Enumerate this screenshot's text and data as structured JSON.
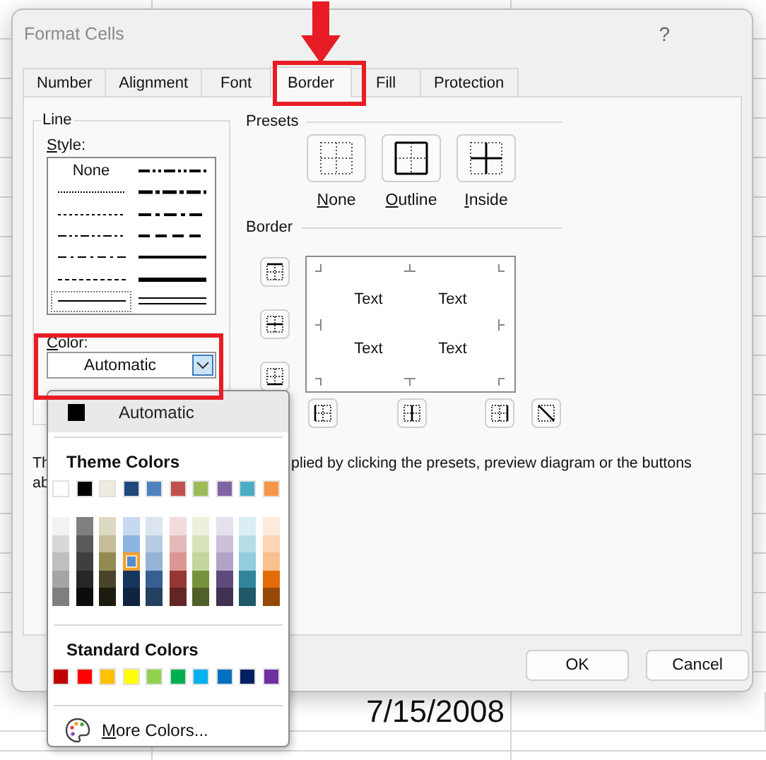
{
  "sheet": {
    "rows": [
      {
        "column_2": "7/15/2008"
      }
    ]
  },
  "window": {
    "title": "Format Cells",
    "help": "?"
  },
  "tabs": [
    {
      "label": "Number",
      "selected": false
    },
    {
      "label": "Alignment",
      "selected": false
    },
    {
      "label": "Font",
      "selected": false
    },
    {
      "label": "Border",
      "selected": true
    },
    {
      "label": "Fill",
      "selected": false
    },
    {
      "label": "Protection",
      "selected": false
    }
  ],
  "line": {
    "title": "Line",
    "style_label": "Style:",
    "styles": [
      {
        "kind": "none",
        "label": "None",
        "selected": false
      },
      {
        "kind": "hair",
        "selected": false
      },
      {
        "kind": "dotted",
        "selected": false
      },
      {
        "kind": "dashdotdot",
        "selected": false
      },
      {
        "kind": "dashdot",
        "selected": false
      },
      {
        "kind": "dashed",
        "selected": false
      },
      {
        "kind": "thin",
        "selected": true
      },
      {
        "kind": "medium_dashdotdot",
        "selected": false
      },
      {
        "kind": "slant_dashdot",
        "selected": false
      },
      {
        "kind": "medium_dashdot",
        "selected": false
      },
      {
        "kind": "medium_dashed",
        "selected": false
      },
      {
        "kind": "medium",
        "selected": false
      },
      {
        "kind": "thick",
        "selected": false
      },
      {
        "kind": "double",
        "selected": false
      }
    ],
    "color_label": "Color:",
    "color_value": "Automatic",
    "color_expanded": true
  },
  "presets": {
    "title": "Presets",
    "buttons": [
      {
        "kind": "none",
        "label": "None"
      },
      {
        "kind": "outline",
        "label": "Outline"
      },
      {
        "kind": "inside",
        "label": "Inside"
      }
    ]
  },
  "border": {
    "title": "Border",
    "side_buttons": [
      {
        "kind": "top"
      },
      {
        "kind": "middle"
      },
      {
        "kind": "bottom"
      }
    ],
    "preview_texts": [
      "Text",
      "Text",
      "Text",
      "Text"
    ],
    "bottom_buttons": [
      {
        "kind": "left"
      },
      {
        "kind": "center"
      },
      {
        "kind": "right"
      },
      {
        "kind": "diagonal_down"
      }
    ]
  },
  "note": {
    "line_1_start": "Th",
    "line_1_end": "plied by clicking the presets, preview diagram or the buttons",
    "line_2_start": "ab"
  },
  "buttons": [
    "OK",
    "Cancel"
  ],
  "color_menu": {
    "automatic": {
      "label": "Automatic",
      "color": "#000000"
    },
    "theme_title": "Theme Colors",
    "theme_colors": [
      {
        "color": "#ffffff",
        "selected": false
      },
      {
        "color": "#000000",
        "selected": false
      },
      {
        "color": "#eeece1",
        "selected": false
      },
      {
        "color": "#1f497d",
        "selected": false
      },
      {
        "color": "#4f81bd",
        "selected": false
      },
      {
        "color": "#c0504d",
        "selected": false
      },
      {
        "color": "#9bbb59",
        "selected": false
      },
      {
        "color": "#8064a2",
        "selected": false
      },
      {
        "color": "#4bacc6",
        "selected": false
      },
      {
        "color": "#f79646",
        "selected": false
      }
    ],
    "theme_shades": [
      [
        {
          "color": "#f2f2f2",
          "selected": false
        },
        {
          "color": "#d8d8d8",
          "selected": false
        },
        {
          "color": "#bfbfbf",
          "selected": false
        },
        {
          "color": "#a5a5a5",
          "selected": false
        },
        {
          "color": "#7f7f7f",
          "selected": false
        }
      ],
      [
        {
          "color": "#7f7f7f",
          "selected": false
        },
        {
          "color": "#595959",
          "selected": false
        },
        {
          "color": "#3f3f3f",
          "selected": false
        },
        {
          "color": "#262626",
          "selected": false
        },
        {
          "color": "#0c0c0c",
          "selected": false
        }
      ],
      [
        {
          "color": "#ddd9c3",
          "selected": false
        },
        {
          "color": "#c4bd97",
          "selected": false
        },
        {
          "color": "#938953",
          "selected": false
        },
        {
          "color": "#494429",
          "selected": false
        },
        {
          "color": "#1d1b10",
          "selected": false
        }
      ],
      [
        {
          "color": "#c6d9f0",
          "selected": false
        },
        {
          "color": "#8db3e2",
          "selected": false
        },
        {
          "color": "#548dd4",
          "selected": true
        },
        {
          "color": "#17365d",
          "selected": false
        },
        {
          "color": "#0f243e",
          "selected": false
        }
      ],
      [
        {
          "color": "#dbe5f1",
          "selected": false
        },
        {
          "color": "#b8cce4",
          "selected": false
        },
        {
          "color": "#95b3d7",
          "selected": false
        },
        {
          "color": "#366092",
          "selected": false
        },
        {
          "color": "#244061",
          "selected": false
        }
      ],
      [
        {
          "color": "#f2dcdb",
          "selected": false
        },
        {
          "color": "#e5b9b7",
          "selected": false
        },
        {
          "color": "#d99694",
          "selected": false
        },
        {
          "color": "#953734",
          "selected": false
        },
        {
          "color": "#632423",
          "selected": false
        }
      ],
      [
        {
          "color": "#ebf1dd",
          "selected": false
        },
        {
          "color": "#d7e3bc",
          "selected": false
        },
        {
          "color": "#c3d69b",
          "selected": false
        },
        {
          "color": "#76923c",
          "selected": false
        },
        {
          "color": "#4f6128",
          "selected": false
        }
      ],
      [
        {
          "color": "#e5e0ec",
          "selected": false
        },
        {
          "color": "#ccc1d9",
          "selected": false
        },
        {
          "color": "#b2a2c7",
          "selected": false
        },
        {
          "color": "#5f497a",
          "selected": false
        },
        {
          "color": "#3f3151",
          "selected": false
        }
      ],
      [
        {
          "color": "#dbeef3",
          "selected": false
        },
        {
          "color": "#b7dde8",
          "selected": false
        },
        {
          "color": "#92cddc",
          "selected": false
        },
        {
          "color": "#31859b",
          "selected": false
        },
        {
          "color": "#205867",
          "selected": false
        }
      ],
      [
        {
          "color": "#fdeada",
          "selected": false
        },
        {
          "color": "#fbd5b5",
          "selected": false
        },
        {
          "color": "#fac08f",
          "selected": false
        },
        {
          "color": "#e36c09",
          "selected": false
        },
        {
          "color": "#974806",
          "selected": false
        }
      ]
    ],
    "standard_title": "Standard Colors",
    "standard_colors": [
      {
        "color": "#c00000",
        "selected": false
      },
      {
        "color": "#ff0000",
        "selected": false
      },
      {
        "color": "#ffc000",
        "selected": false
      },
      {
        "color": "#ffff00",
        "selected": false
      },
      {
        "color": "#92d050",
        "selected": false
      },
      {
        "color": "#00b050",
        "selected": false
      },
      {
        "color": "#00b0f0",
        "selected": false
      },
      {
        "color": "#0070c0",
        "selected": false
      },
      {
        "color": "#002060",
        "selected": false
      },
      {
        "color": "#7030a0",
        "selected": false
      }
    ],
    "more": "More Colors..."
  }
}
